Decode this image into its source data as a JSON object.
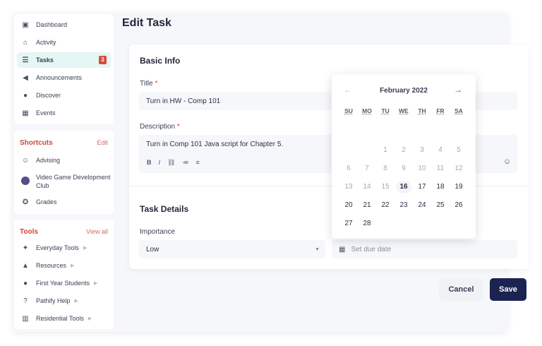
{
  "nav": [
    {
      "label": "Dashboard",
      "icon": "dashboard-icon"
    },
    {
      "label": "Activity",
      "icon": "home-icon"
    },
    {
      "label": "Tasks",
      "icon": "tasks-icon",
      "badge": "3"
    },
    {
      "label": "Announcements",
      "icon": "megaphone-icon"
    },
    {
      "label": "Discover",
      "icon": "compass-icon"
    },
    {
      "label": "Events",
      "icon": "calendar-icon"
    }
  ],
  "shortcuts": {
    "title": "Shortcuts",
    "action": "Edit",
    "items": [
      {
        "label": "Advising"
      },
      {
        "label": "Video Game Development"
      },
      {
        "label": "Club"
      },
      {
        "label": "Grades"
      }
    ]
  },
  "tools": {
    "title": "Tools",
    "action": "View all",
    "items": [
      {
        "label": "Everyday Tools"
      },
      {
        "label": "Resources"
      },
      {
        "label": "First Year Students"
      },
      {
        "label": "Pathify Help"
      },
      {
        "label": "Residential Tools"
      }
    ]
  },
  "page_title": "Edit Task",
  "basic": {
    "heading": "Basic Info",
    "title_label": "Title",
    "required": "*",
    "title_value": "Turn in HW - Comp 101",
    "desc_label": "Description",
    "desc_value": "Turn in Comp 101 Java script for Chapter 5."
  },
  "details": {
    "heading": "Task Details",
    "importance_label": "Importance",
    "importance_value": "Low",
    "due_placeholder": "Set due date"
  },
  "calendar": {
    "month": "February 2022",
    "weekdays": [
      "SU",
      "MO",
      "TU",
      "WE",
      "TH",
      "FR",
      "SA"
    ],
    "first_weekday": 2,
    "days_in_month": 28,
    "first_enabled": 16,
    "today": 16
  },
  "buttons": {
    "cancel": "Cancel",
    "save": "Save"
  },
  "colors": {
    "accent": "#d0453c",
    "primary": "#1b2350"
  }
}
